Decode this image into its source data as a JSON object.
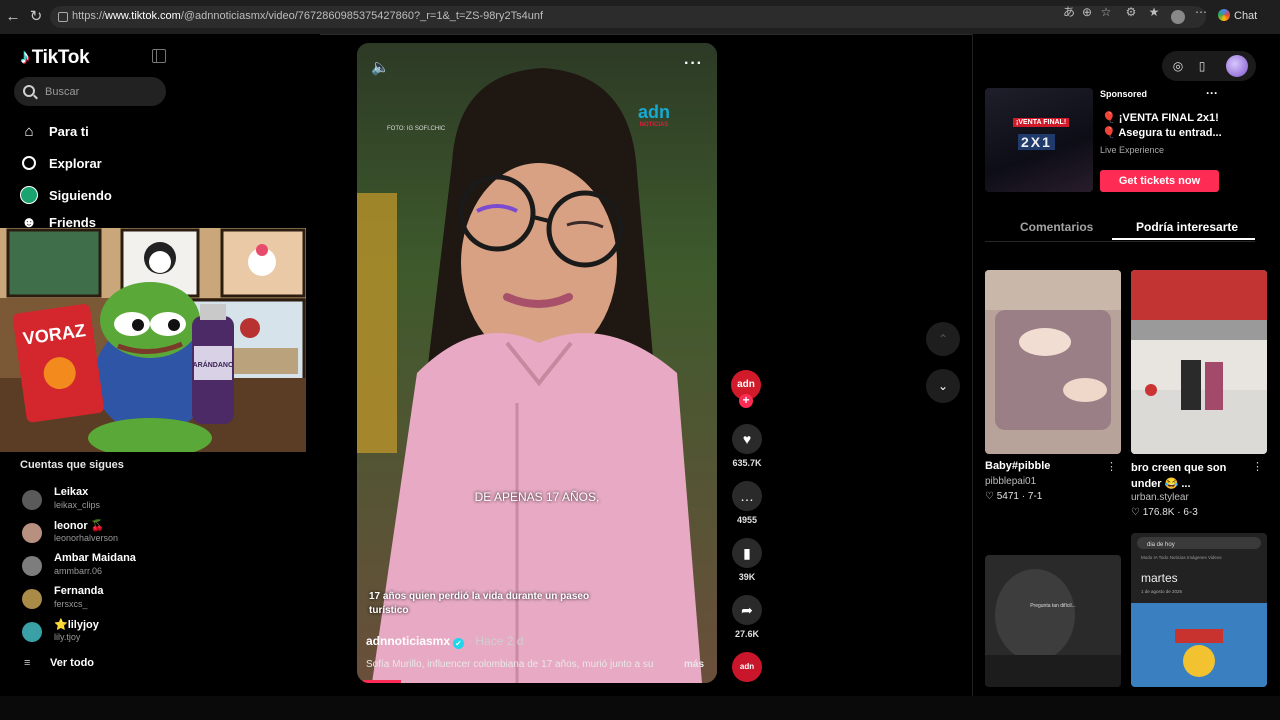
{
  "browser": {
    "url_prefix": "https://",
    "url_host": "www.tiktok.com",
    "url_path": "/@adnnoticiasmx/video/7672860985375427860?_r=1&_t=ZS-98ry2Ts4unf",
    "chat_label": "Chat"
  },
  "sidebar": {
    "logo": "TikTok",
    "search_placeholder": "Buscar",
    "nav": [
      {
        "label": "Para ti",
        "icon": "home-icon"
      },
      {
        "label": "Explorar",
        "icon": "compass-icon"
      },
      {
        "label": "Siguiendo",
        "icon": "following-avatar-icon"
      },
      {
        "label": "Friends",
        "icon": "friends-icon"
      }
    ],
    "following_title": "Cuentas que sigues",
    "accounts": [
      {
        "name": "Leikax",
        "handle": "leikax_clips",
        "color": "#5a5a5a"
      },
      {
        "name": "leonor 🍒",
        "handle": "leonorhalverson",
        "color": "#b89080"
      },
      {
        "name": "Ambar Maidana",
        "handle": "ammbarr.06",
        "color": "#7d7d7d"
      },
      {
        "name": "Fernanda",
        "handle": "fersxcs_",
        "color": "#a98a46"
      },
      {
        "name": "⭐lilyjoy",
        "handle": "lily.tjoy",
        "color": "#3aa0a8"
      }
    ],
    "see_all": "Ver todo"
  },
  "pip": {
    "bag_text": "VORAZ",
    "bottle_text": "ARÁNDANO"
  },
  "video": {
    "credit": "FOTO: IG SOFI.CHIC",
    "watermark": "adn",
    "watermark_sub": "NOTICIAS",
    "caption": "DE APENAS 17 AÑOS,",
    "desc_title": "17 años quien perdió la vida durante un paseo turístico",
    "author": "adnnoticiasmx",
    "when": "· Hace 2 d",
    "description": "Sofía Murillo, influencer colombiana de 17 años, murió junto a su",
    "more": "más",
    "progress": 0.11
  },
  "actions": {
    "avatar_text": "adn",
    "likes": "635.7K",
    "comments": "4955",
    "saves": "39K",
    "shares": "27.6K",
    "disc_text": "adn"
  },
  "ad": {
    "sponsored": "Sponsored",
    "line1": "🎈 ¡VENTA FINAL 2x1!",
    "line2": "🎈 Asegura tu entrad...",
    "brand": "Live Experience",
    "cta": "Get tickets now",
    "thumb_tag": "¡VENTA FINAL!",
    "thumb_big": "2X1"
  },
  "tabs": {
    "comments": "Comentarios",
    "recommend": "Podría interesarte"
  },
  "cards": [
    {
      "title": "Baby#pibble",
      "user": "pibblepai01",
      "likes": "5471",
      "date": "7-1"
    },
    {
      "title": "bro creen que son under 😂 ...",
      "user": "urban.stylear",
      "likes": "176.8K",
      "date": "6-3"
    },
    {
      "overlay": "Pregunta tan difícil..."
    },
    {
      "search": "dia de hoy",
      "tabs": "Modo IA  Todo  Noticias  Imágenes  Videos",
      "heading": "martes",
      "sub": "1 de agosto de 2026"
    }
  ],
  "colors": {
    "accent": "#fe2c55",
    "verified": "#20d5ec"
  }
}
